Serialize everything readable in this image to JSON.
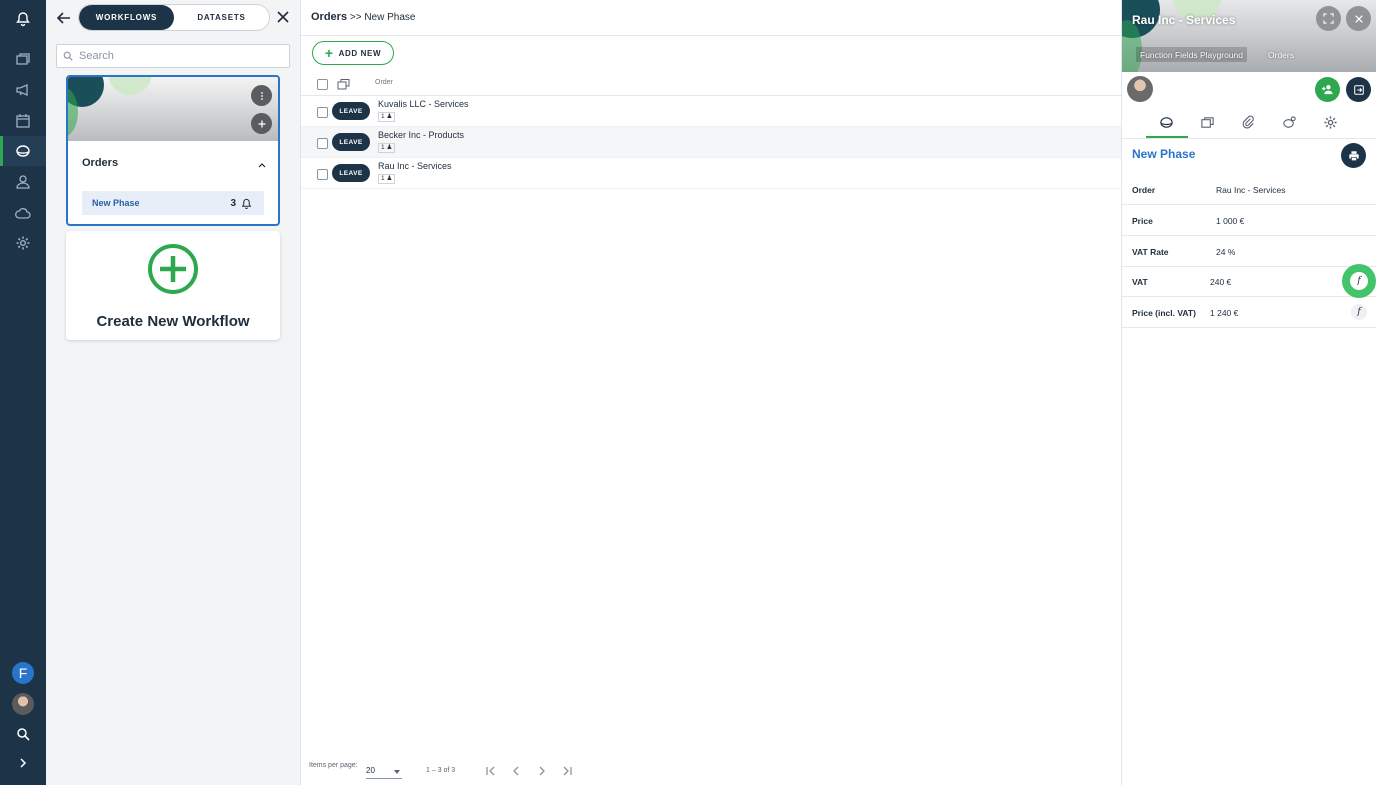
{
  "workflow_panel": {
    "tabs": [
      "WORKFLOWS",
      "DATASETS"
    ],
    "search_placeholder": "Search",
    "workflow": {
      "title": "Orders",
      "phase": "New Phase",
      "phase_count": "3"
    },
    "create_label": "Create New Workflow"
  },
  "rail": {
    "user_initial": "F",
    "icons": [
      "bell-icon",
      "cards-icon",
      "megaphone-icon",
      "calendar-icon",
      "workflow-icon",
      "users-icon",
      "cloud-icon",
      "gear-icon",
      "search-icon",
      "chevron-right-icon"
    ]
  },
  "main": {
    "breadcrumb_root": "Orders",
    "breadcrumb_sep": ">>",
    "breadcrumb_phase": "New Phase",
    "add_new_label": "ADD NEW",
    "column_order": "Order",
    "rows": [
      {
        "action": "LEAVE",
        "title": "Kuvalis LLC - Services",
        "count": "1"
      },
      {
        "action": "LEAVE",
        "title": "Becker Inc - Products",
        "count": "1"
      },
      {
        "action": "LEAVE",
        "title": "Rau Inc - Services",
        "count": "1"
      }
    ],
    "footer": {
      "items_per_page_label": "Items per page:",
      "items_per_page_value": "20",
      "range": "1 – 3 of 3"
    }
  },
  "detail": {
    "title": "Rau Inc - Services",
    "chip_workflow": "Function Fields Playground",
    "chip_orders": "Orders",
    "phase": "New Phase",
    "fields": [
      {
        "label": "Order",
        "value": "Rau Inc - Services"
      },
      {
        "label": "Price",
        "value": "1 000 €"
      },
      {
        "label": "VAT Rate",
        "value": "24 %"
      },
      {
        "label": "VAT",
        "value": "240 €"
      },
      {
        "label": "Price (incl. VAT)",
        "value": "1 240 €"
      }
    ],
    "function_label": "f"
  },
  "colors": {
    "navy": "#1d3347",
    "green": "#2ea84f",
    "blue": "#2a75c9"
  }
}
